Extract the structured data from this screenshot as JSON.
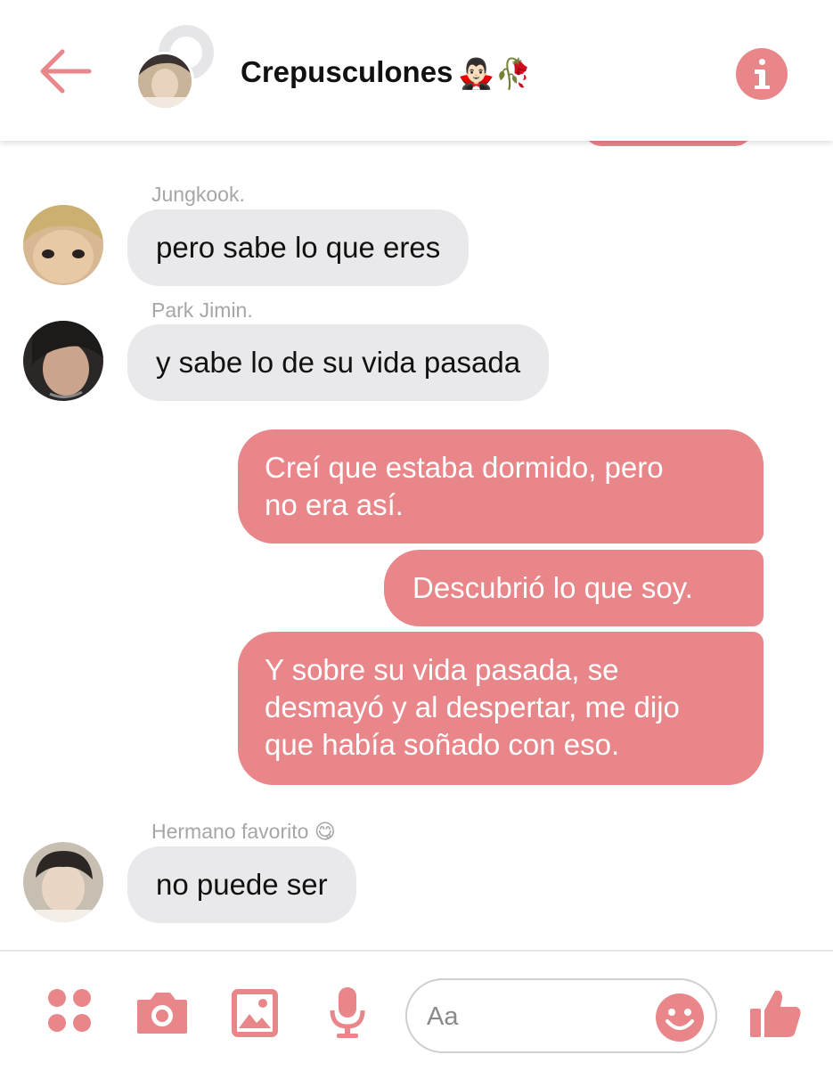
{
  "header": {
    "title": "Crepusculones",
    "title_emojis": "🧛🏻‍♂️🥀",
    "back_icon": "arrow-left-icon",
    "info_icon": "info-icon"
  },
  "messages": [
    {
      "direction": "in",
      "sender": "Jungkook.",
      "text": "pero sabe lo que eres"
    },
    {
      "direction": "in",
      "sender": "Park Jimin.",
      "text": "y sabe lo de su vida pasada"
    },
    {
      "direction": "out",
      "lines": [
        "Creí que estaba dormido, pero",
        "no era así."
      ]
    },
    {
      "direction": "out",
      "lines": [
        "Descubrió lo que soy."
      ]
    },
    {
      "direction": "out",
      "lines": [
        "Y sobre su vida pasada, se",
        "desmayó y al despertar, me dijo",
        "que había soñado con eso."
      ]
    },
    {
      "direction": "in",
      "sender": "Hermano favorito",
      "sender_emoji": "😋",
      "text": "no puede ser"
    }
  ],
  "composer": {
    "placeholder": "Aa",
    "icons": [
      "apps-icon",
      "camera-icon",
      "image-icon",
      "microphone-icon",
      "emoji-icon",
      "thumbs-up-icon"
    ]
  },
  "colors": {
    "accent": "#e8868a",
    "incoming_bubble": "#e9e9eb",
    "sender_label": "#a6a6a6"
  }
}
